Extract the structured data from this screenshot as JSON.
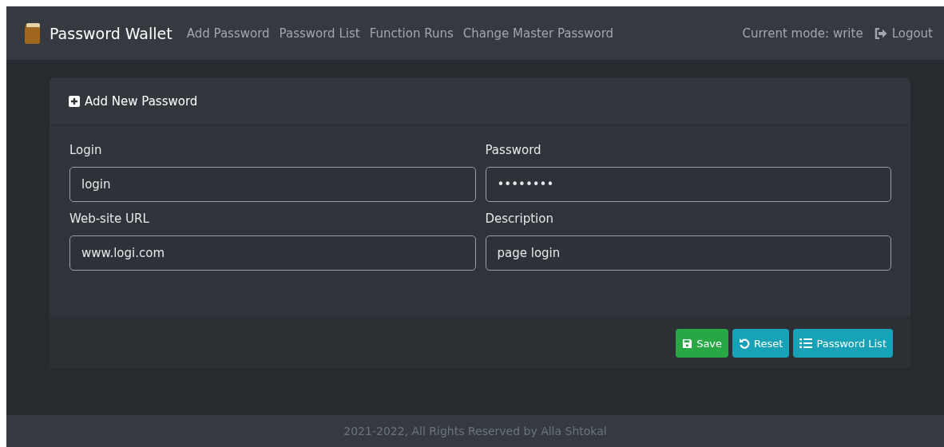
{
  "navbar": {
    "brand": "Password Wallet",
    "links": [
      {
        "label": "Add Password",
        "selected": false
      },
      {
        "label": "Password List",
        "selected": false
      },
      {
        "label": "Function Runs",
        "selected": false
      },
      {
        "label": "Change Master Password",
        "selected": false
      }
    ],
    "mode": "Current mode: write",
    "logout": "Logout"
  },
  "card": {
    "title": "Add New Password",
    "fields": [
      {
        "label": "Login",
        "value": "login"
      },
      {
        "label": "Password",
        "value": "••••••••"
      },
      {
        "label": "Web-site URL",
        "value": "www.logi.com"
      },
      {
        "label": "Description",
        "value": "page login"
      }
    ],
    "buttons": [
      {
        "kind": "save",
        "label": "Save"
      },
      {
        "kind": "reset",
        "label": "Reset"
      },
      {
        "kind": "list",
        "label": "Password List"
      }
    ]
  },
  "footer": "2021-2022, All Rights Reserved by Alla Shtokal"
}
